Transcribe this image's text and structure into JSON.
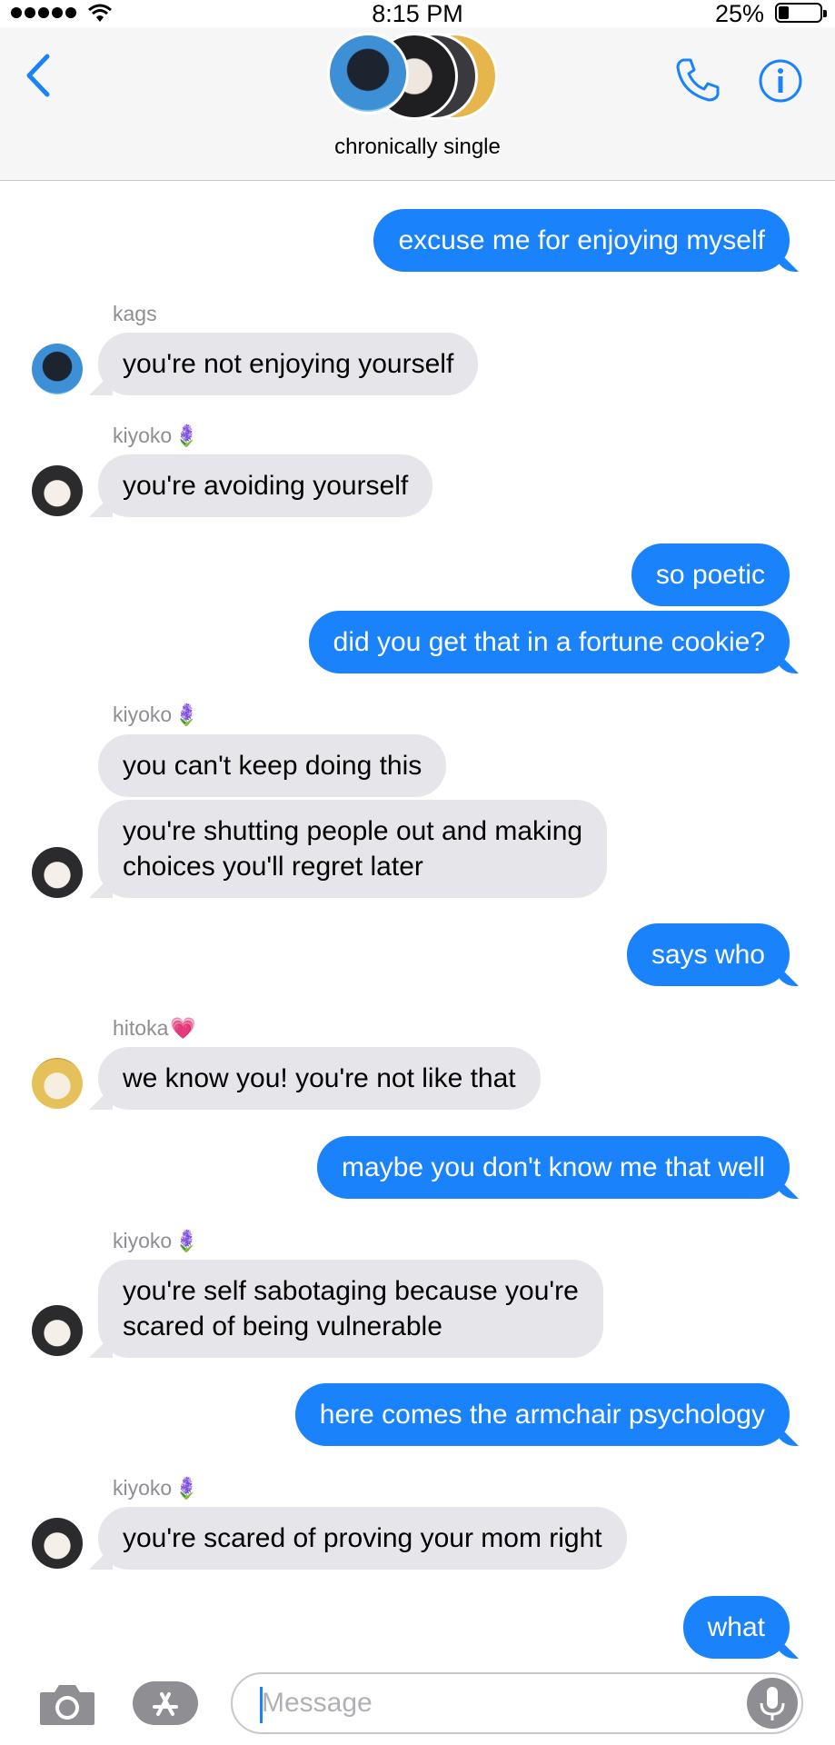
{
  "status_bar": {
    "time": "8:15 PM",
    "battery_percent": "25%",
    "battery_level": 0.25
  },
  "header": {
    "group_name": "chronically single",
    "back_icon": "chevron-left-icon",
    "call_icon": "phone-icon",
    "info_icon": "info-icon"
  },
  "thread": {
    "messages": [
      {
        "dir": "out",
        "text": "excuse me for enjoying myself"
      },
      {
        "sender": "kags",
        "dir": "in",
        "text": "you're not enjoying yourself"
      },
      {
        "sender": "kiyoko",
        "dir": "in",
        "text": "you're avoiding yourself"
      },
      {
        "dir": "out",
        "text": "so poetic"
      },
      {
        "dir": "out",
        "text": "did you get that in a fortune cookie?"
      },
      {
        "sender": "kiyoko",
        "dir": "in",
        "text": "you can't keep doing this"
      },
      {
        "dir": "in",
        "text_line1": "you're shutting people out and making",
        "text_line2": "choices you'll regret later"
      },
      {
        "dir": "out",
        "text": "says who"
      },
      {
        "sender": "hitoka",
        "dir": "in",
        "text": "we know you! you're not like that"
      },
      {
        "dir": "out",
        "text": "maybe you don't know me that well"
      },
      {
        "sender": "kiyoko",
        "dir": "in",
        "text_line1": "you're self sabotaging because you're",
        "text_line2": "scared of being vulnerable"
      },
      {
        "dir": "out",
        "text": "here comes the armchair psychology"
      },
      {
        "sender": "kiyoko",
        "dir": "in",
        "text": "you're scared of proving your mom right"
      },
      {
        "dir": "out",
        "text": "what"
      }
    ]
  },
  "input_bar": {
    "placeholder": "Message",
    "camera_icon": "camera-icon",
    "apps_icon": "app-store-icon",
    "mic_icon": "microphone-icon"
  },
  "colors": {
    "outgoing": "#1a82fb",
    "incoming": "#e5e5ea",
    "accent": "#1a82fb"
  }
}
